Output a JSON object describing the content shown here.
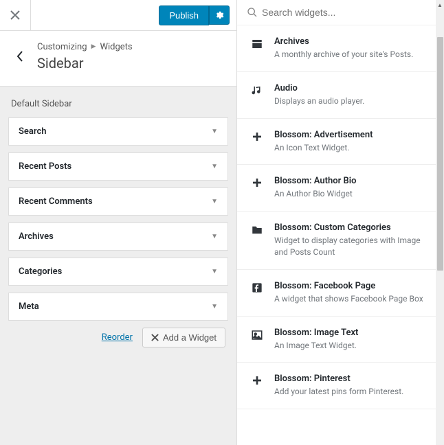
{
  "topbar": {
    "publish": "Publish"
  },
  "header": {
    "crumb1": "Customizing",
    "crumb2": "Widgets",
    "title": "Sidebar"
  },
  "sidebar": {
    "subtitle": "Default Sidebar",
    "items": [
      {
        "label": "Search"
      },
      {
        "label": "Recent Posts"
      },
      {
        "label": "Recent Comments"
      },
      {
        "label": "Archives"
      },
      {
        "label": "Categories"
      },
      {
        "label": "Meta"
      }
    ],
    "reorder": "Reorder",
    "add": "Add a Widget"
  },
  "search": {
    "placeholder": "Search widgets..."
  },
  "available": [
    {
      "icon": "archive",
      "title": "Archives",
      "desc": "A monthly archive of your site's Posts."
    },
    {
      "icon": "audio",
      "title": "Audio",
      "desc": "Displays an audio player."
    },
    {
      "icon": "plus",
      "title": "Blossom: Advertisement",
      "desc": "An Icon Text Widget."
    },
    {
      "icon": "plus",
      "title": "Blossom: Author Bio",
      "desc": "An Author Bio Widget"
    },
    {
      "icon": "folder",
      "title": "Blossom: Custom Categories",
      "desc": "Widget to display categories with Image and Posts Count"
    },
    {
      "icon": "facebook",
      "title": "Blossom: Facebook Page",
      "desc": "A widget that shows Facebook Page Box"
    },
    {
      "icon": "image",
      "title": "Blossom: Image Text",
      "desc": "An Image Text Widget."
    },
    {
      "icon": "plus",
      "title": "Blossom: Pinterest",
      "desc": "Add your latest pins form Pinterest."
    }
  ]
}
